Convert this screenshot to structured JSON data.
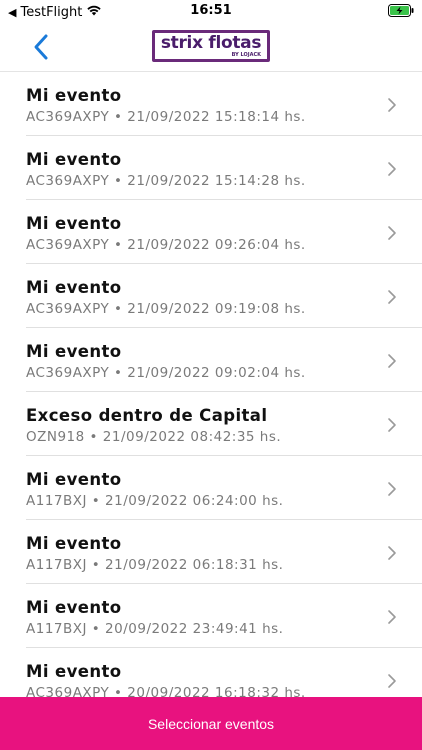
{
  "status_bar": {
    "carrier": "TestFlight",
    "time": "16:51"
  },
  "header": {
    "logo_main": "strix flotas",
    "logo_sub": "BY LOJACK",
    "accent_color": "#1a7ad9"
  },
  "events": [
    {
      "title": "Mi evento",
      "subtitle": "AC369AXPY • 21/09/2022 15:18:14 hs."
    },
    {
      "title": "Mi evento",
      "subtitle": "AC369AXPY • 21/09/2022 15:14:28 hs."
    },
    {
      "title": "Mi evento",
      "subtitle": "AC369AXPY • 21/09/2022 09:26:04 hs."
    },
    {
      "title": "Mi evento",
      "subtitle": "AC369AXPY • 21/09/2022 09:19:08 hs."
    },
    {
      "title": "Mi evento",
      "subtitle": "AC369AXPY • 21/09/2022 09:02:04 hs."
    },
    {
      "title": "Exceso dentro de Capital",
      "subtitle": "OZN918 • 21/09/2022 08:42:35 hs."
    },
    {
      "title": "Mi evento",
      "subtitle": "A117BXJ • 21/09/2022 06:24:00 hs."
    },
    {
      "title": "Mi evento",
      "subtitle": "A117BXJ • 21/09/2022 06:18:31 hs."
    },
    {
      "title": "Mi evento",
      "subtitle": "A117BXJ • 20/09/2022 23:49:41 hs."
    },
    {
      "title": "Mi evento",
      "subtitle": "AC369AXPY • 20/09/2022 16:18:32 hs."
    }
  ],
  "footer": {
    "select_label": "Seleccionar eventos",
    "bar_color": "#e8127f"
  },
  "icons": {
    "back": "chevron-left-icon",
    "row": "chevron-right-icon",
    "wifi": "wifi-icon",
    "battery": "battery-charging-icon"
  }
}
